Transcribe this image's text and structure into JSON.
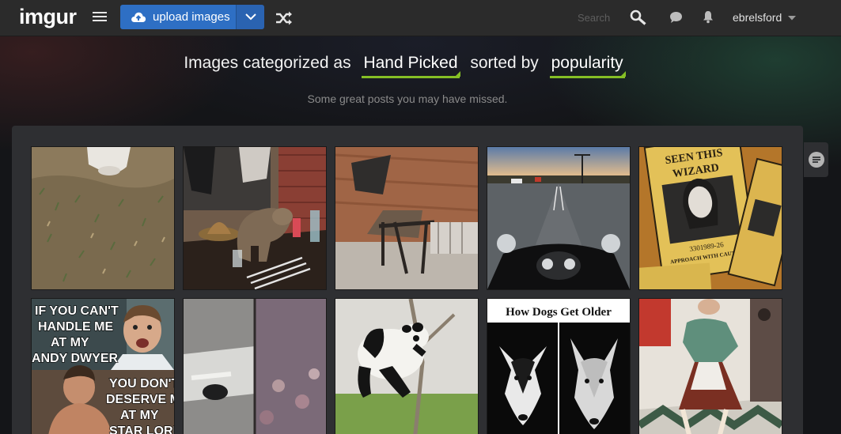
{
  "header": {
    "logo": "imgur",
    "upload_label": "upload images",
    "search_placeholder": "Search",
    "username": "ebrelsford"
  },
  "heading": {
    "prefix": "Images categorized as",
    "category": "Hand Picked",
    "middle": "sorted by",
    "sort": "popularity",
    "subtitle": "Some great posts you may have missed."
  },
  "thumb_text": {
    "meme_lines_top": [
      "IF YOU CAN'T",
      "HANDLE ME",
      "AT MY",
      "ANDY DWYER"
    ],
    "meme_lines_bottom": [
      "YOU DON'T",
      "DESERVE ME",
      "AT MY",
      "STAR LORD"
    ],
    "dogs_title": "How Dogs Get Older",
    "poster_lines": [
      "SEEN THIS",
      "WIZARD",
      "3301989-26",
      "APPROACH WITH CAUTION"
    ]
  },
  "gallery": {
    "rows": 2,
    "columns": 5
  },
  "colors": {
    "accent_green": "#85bf25",
    "upload_blue": "#2e6fc4",
    "topbar": "#2b2b2b",
    "panel": "#2e2f32"
  },
  "icons": [
    "menu-icon",
    "cloud-upload-icon",
    "chevron-down-icon",
    "shuffle-icon",
    "search-icon",
    "chat-icon",
    "bell-icon",
    "caret-down-icon",
    "comments-icon"
  ]
}
